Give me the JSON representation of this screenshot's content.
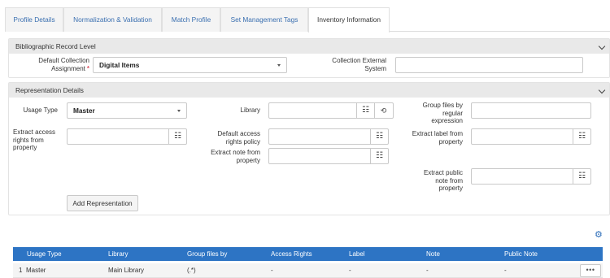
{
  "tabs": [
    {
      "label": "Profile Details",
      "active": false
    },
    {
      "label": "Normalization & Validation",
      "active": false
    },
    {
      "label": "Match Profile",
      "active": false
    },
    {
      "label": "Set Management Tags",
      "active": false
    },
    {
      "label": "Inventory Information",
      "active": true
    }
  ],
  "bib_section": {
    "title": "Bibliographic Record Level",
    "default_collection_label": "Default Collection Assignment",
    "required_mark": "*",
    "default_collection_value": "Digital Items",
    "external_system_label": "Collection External System",
    "external_system_value": ""
  },
  "rep_section": {
    "title": "Representation Details",
    "usage_type_label": "Usage Type",
    "usage_type_value": "Master",
    "library_label": "Library",
    "library_value": "",
    "group_files_label": "Group files by regular expression",
    "group_files_value": "",
    "access_rights_label": "Extract access rights from property",
    "access_rights_value": "",
    "default_policy_label": "Default access rights policy",
    "default_policy_value": "",
    "extract_label_label": "Extract label from property",
    "extract_label_value": "",
    "extract_note_label": "Extract note from property",
    "extract_note_value": "",
    "public_note_label": "Extract public note from property",
    "public_note_value": "",
    "add_button": "Add Representation"
  },
  "table": {
    "columns": [
      "Usage Type",
      "Library",
      "Group files by",
      "Access Rights",
      "Label",
      "Note",
      "Public Note"
    ],
    "rows": [
      {
        "index": "1",
        "usage_type": "Master",
        "library": "Main Library",
        "group_files_by": "(.*)",
        "access_rights": "-",
        "label": "-",
        "note": "-",
        "public_note": "-",
        "actions": "•••"
      }
    ]
  },
  "icons": {
    "list": "list-icon",
    "history": "history-icon",
    "gear": "gear-icon",
    "chevron": "chevron-down-icon",
    "more": "more-actions-icon"
  },
  "colors": {
    "accent": "#2d74c4",
    "link": "#3a6fb0",
    "required": "#d0021b",
    "section_header": "#e9e9e9"
  }
}
